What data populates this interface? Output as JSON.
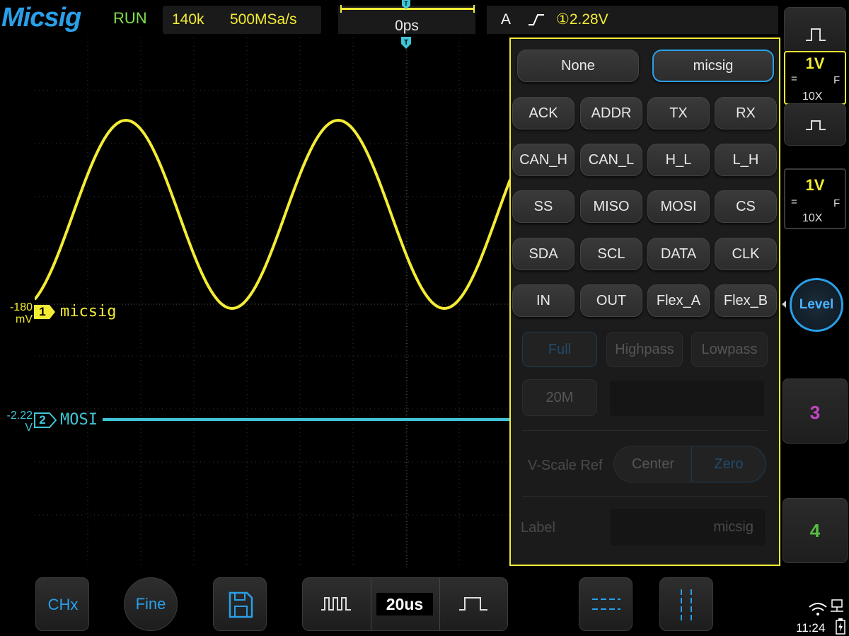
{
  "header": {
    "brand": "Micsig",
    "run_state": "RUN",
    "memory_depth": "140k",
    "sample_rate": "500MSa/s",
    "horizontal_position": "0ps",
    "trigger_mode": "A",
    "trigger_edge": "rising-edge-icon",
    "trigger_level": "①2.28V"
  },
  "waveform": {
    "ch1": {
      "offset_line1": "-180",
      "offset_line2": "mV",
      "tag": "1",
      "label": "micsig",
      "color": "#f4ec34"
    },
    "ch2": {
      "offset_line1": "-2.22",
      "offset_line2": "V",
      "tag": "2",
      "label": "MOSI",
      "color": "#3fc5d6"
    }
  },
  "label_panel": {
    "selected_label": "micsig",
    "top_options": [
      "None",
      "micsig"
    ],
    "presets": [
      [
        "ACK",
        "ADDR",
        "TX",
        "RX"
      ],
      [
        "CAN_H",
        "CAN_L",
        "H_L",
        "L_H"
      ],
      [
        "SS",
        "MISO",
        "MOSI",
        "CS"
      ],
      [
        "SDA",
        "SCL",
        "DATA",
        "CLK"
      ],
      [
        "IN",
        "OUT",
        "Flex_A",
        "Flex_B"
      ]
    ],
    "bandwidth": {
      "full": "Full",
      "highpass": "Highpass",
      "lowpass": "Lowpass",
      "limit": "20M"
    },
    "vscale_ref": {
      "label": "V-Scale Ref",
      "center": "Center",
      "zero": "Zero",
      "selected": "Zero"
    },
    "label_field": {
      "label": "Label",
      "value": "micsig"
    }
  },
  "right_column": {
    "ch1": {
      "vdiv": "1V",
      "coupling": "=",
      "bw": "F",
      "probe": "10X",
      "color": "#f4ec34"
    },
    "ch2": {
      "vdiv": "1V",
      "coupling": "=",
      "bw": "F",
      "probe": "10X",
      "color": "#f4ec34"
    },
    "level_button": "Level",
    "ch3": {
      "label": "3",
      "color": "#c147c4"
    },
    "ch4": {
      "label": "4",
      "color": "#57c040"
    }
  },
  "bottom_bar": {
    "chx": "CHx",
    "fine": "Fine",
    "save_icon": "save-icon",
    "timebase": "20us",
    "clock": "11:24"
  },
  "colors": {
    "accent": "#2a9fe8",
    "ch1": "#f4ec34",
    "ch2": "#3fc5d6"
  }
}
